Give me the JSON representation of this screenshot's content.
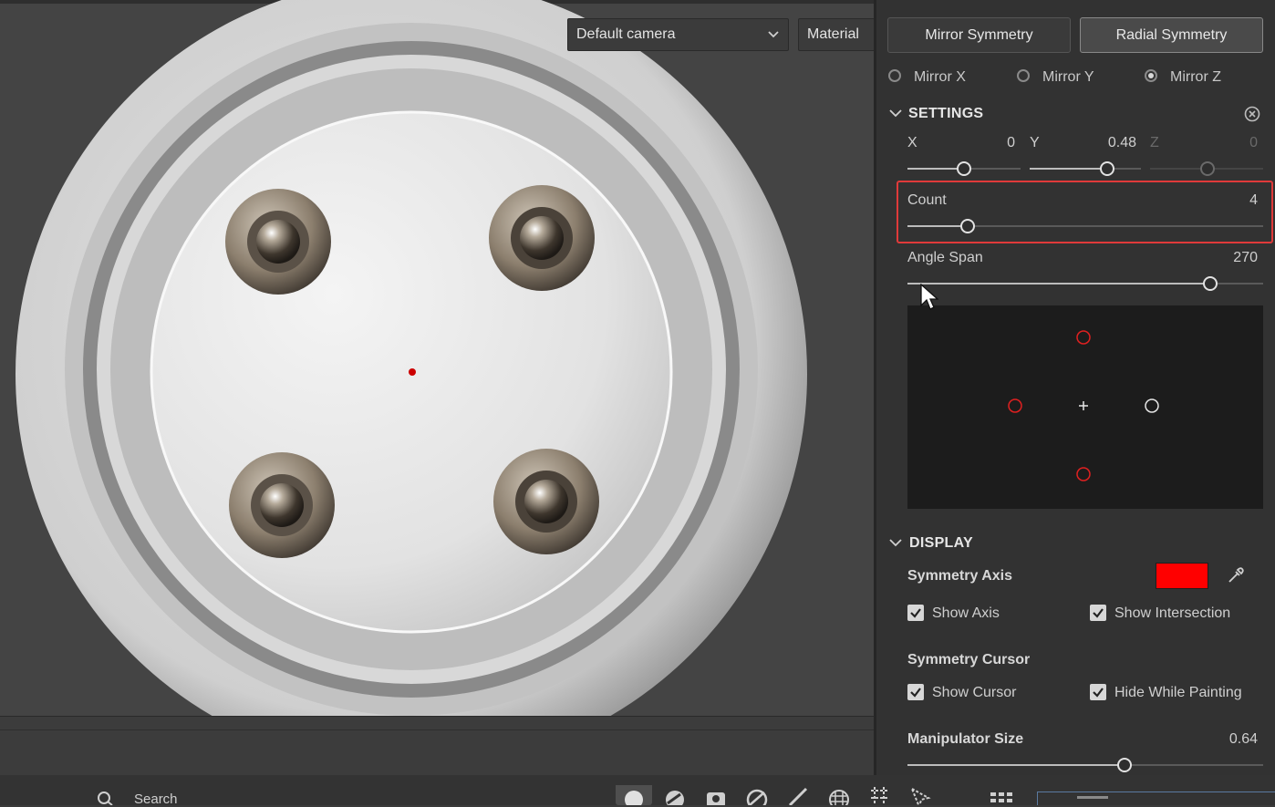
{
  "viewport": {
    "camera_dropdown": "Default camera",
    "material_dropdown": "Material"
  },
  "symmetry_tabs": [
    {
      "label": "Mirror Symmetry",
      "active": false
    },
    {
      "label": "Radial Symmetry",
      "active": true
    }
  ],
  "mirror_axes": [
    {
      "label": "Mirror X",
      "selected": false
    },
    {
      "label": "Mirror Y",
      "selected": false
    },
    {
      "label": "Mirror Z",
      "selected": true
    }
  ],
  "settings": {
    "title": "SETTINGS",
    "x": {
      "label": "X",
      "value": "0"
    },
    "y": {
      "label": "Y",
      "value": "0.48"
    },
    "z": {
      "label": "Z",
      "value": "0"
    },
    "count": {
      "label": "Count",
      "value": "4",
      "fraction": 0.17
    },
    "angle_span": {
      "label": "Angle Span",
      "value": "270",
      "fraction": 0.85
    }
  },
  "display": {
    "title": "DISPLAY",
    "symmetry_axis_label": "Symmetry Axis",
    "axis_color": "#ff0000",
    "show_axis": {
      "label": "Show Axis",
      "checked": true
    },
    "show_intersection": {
      "label": "Show Intersection",
      "checked": true
    },
    "symmetry_cursor_label": "Symmetry Cursor",
    "show_cursor": {
      "label": "Show Cursor",
      "checked": true
    },
    "hide_while_painting": {
      "label": "Hide While Painting",
      "checked": true
    },
    "manipulator_size": {
      "label": "Manipulator Size",
      "value": "0.64",
      "fraction": 0.61
    }
  },
  "bottom_toolbar": {
    "search_label": "Search"
  },
  "icons": [
    "chevron-down-icon",
    "reset-icon",
    "eyedropper-icon",
    "search-icon",
    "check-icon"
  ]
}
